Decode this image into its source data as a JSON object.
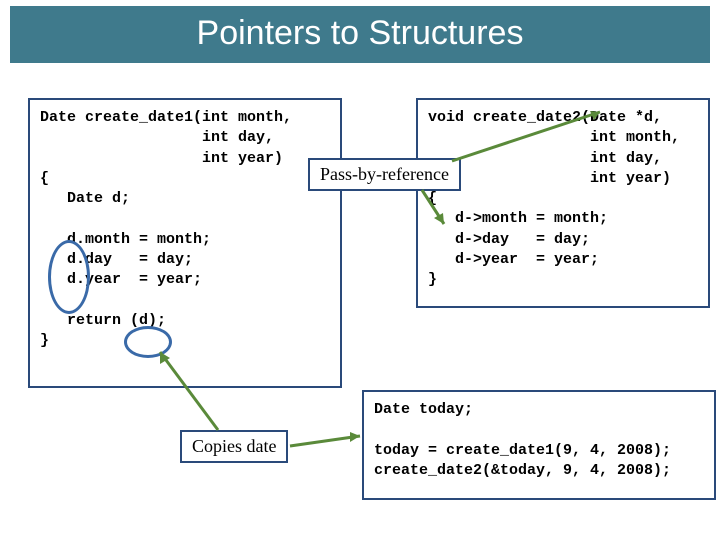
{
  "title": "Pointers to Structures",
  "code_left": "Date create_date1(int month,\n                  int day,\n                  int year)\n{\n   Date d;\n\n   d.month = month;\n   d.day   = day;\n   d.year  = year;\n\n   return (d);\n}",
  "code_right_top": "void create_date2(Date *d,\n                  int month,\n                  int day,\n                  int year)\n{\n   d->month = month;\n   d->day   = day;\n   d->year  = year;\n}",
  "code_right_bottom": "Date today;\n\ntoday = create_date1(9, 4, 2008);\ncreate_date2(&today, 9, 4, 2008);",
  "label_pass_by_ref": "Pass-by-reference",
  "label_copies_date": "Copies date"
}
